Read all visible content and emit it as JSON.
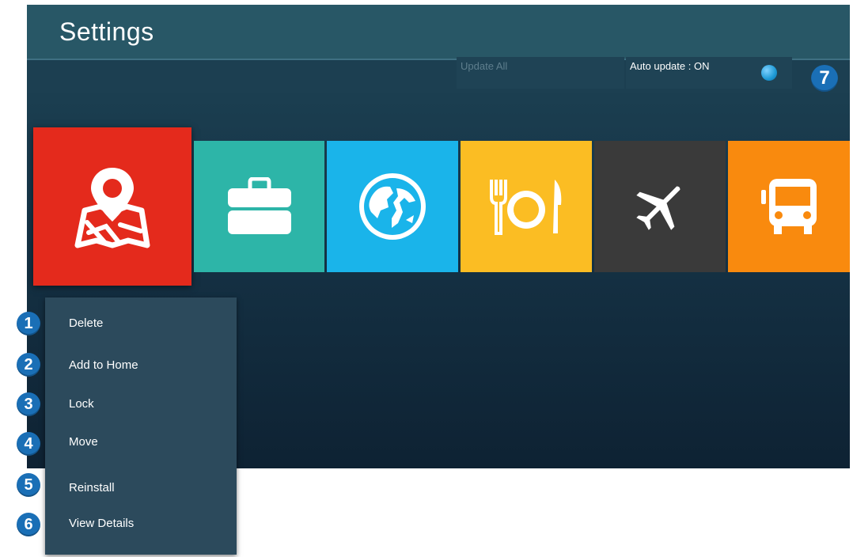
{
  "header": {
    "title": "Settings"
  },
  "toolbar": {
    "update_all_label": "Update All",
    "auto_update_label": "Auto update : ON"
  },
  "tiles": [
    {
      "name": "map-app",
      "icon": "map-pin-icon",
      "color": "#e42a1c",
      "selected": true
    },
    {
      "name": "briefcase-app",
      "icon": "briefcase-icon",
      "color": "#2db5a8"
    },
    {
      "name": "globe-app",
      "icon": "globe-icon",
      "color": "#1ab4ea"
    },
    {
      "name": "dining-app",
      "icon": "fork-plate-knife-icon",
      "color": "#fbbd23"
    },
    {
      "name": "airplane-app",
      "icon": "airplane-icon",
      "color": "#3a3a3a"
    },
    {
      "name": "bus-app",
      "icon": "bus-icon",
      "color": "#f98a0e"
    }
  ],
  "context_menu": {
    "items": [
      {
        "label": "Delete",
        "badge": "1"
      },
      {
        "label": "Add to Home",
        "badge": "2"
      },
      {
        "label": "Lock",
        "badge": "3"
      },
      {
        "label": "Move",
        "badge": "4"
      },
      {
        "label": "Reinstall",
        "badge": "5"
      },
      {
        "label": "View Details",
        "badge": "6"
      }
    ]
  },
  "callout_7": "7",
  "colors": {
    "header": "#285766",
    "menu": "#2c4a5c",
    "badge": "#1a6fb6",
    "toggle": "#1e9ad6"
  }
}
